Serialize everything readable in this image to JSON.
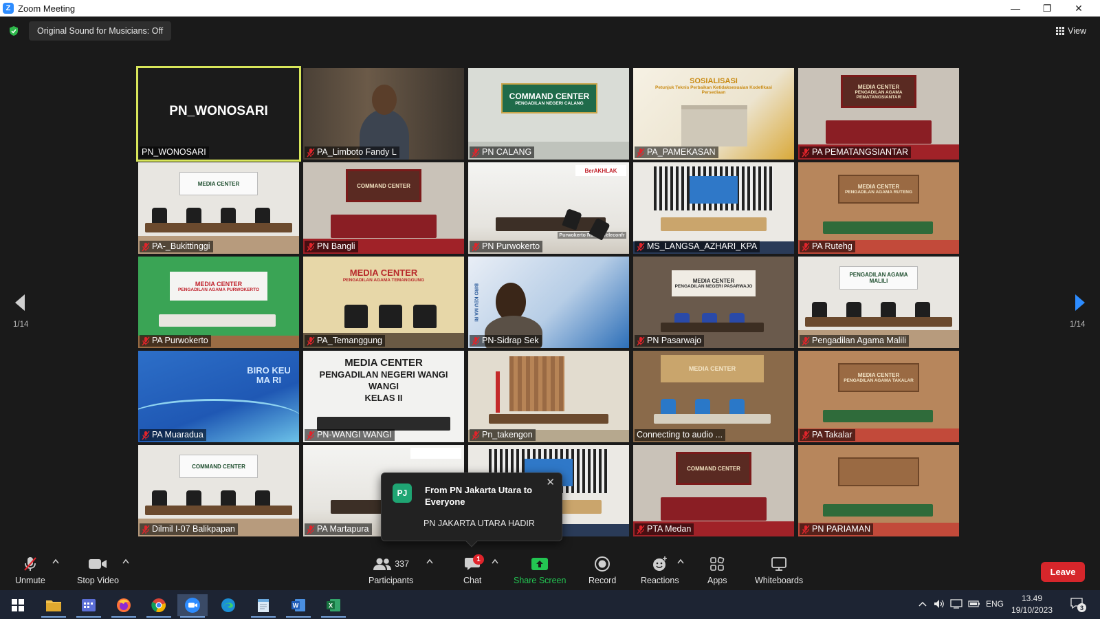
{
  "window": {
    "title": "Zoom Meeting",
    "controls": [
      "minimize-icon",
      "restore-icon",
      "close-icon"
    ]
  },
  "topbar": {
    "sound_label": "Original Sound for Musicians: Off",
    "view_label": "View",
    "security": "shield-check-icon",
    "shield_color": "#2eb84b"
  },
  "grid": {
    "page_left": "1/14",
    "page_right": "1/14",
    "active_tile_color": "#d8e65a",
    "tiles": [
      {
        "name": "PN_WONOSARI",
        "big_label": "PN_WONOSARI",
        "muted": false,
        "scene": "blank",
        "active": true
      },
      {
        "name": "PA_Limboto Fandy L",
        "muted": true,
        "scene": "person"
      },
      {
        "name": "PN CALANG",
        "muted": true,
        "scene": "command-center",
        "wall_text": "COMMAND CENTER",
        "wall_sub": "PENGADILAN NEGERI CALANG"
      },
      {
        "name": "PA_PAMEKASAN",
        "muted": true,
        "scene": "poster",
        "wall_text": "SOSIALISASI",
        "wall_sub": "Petunjuk Teknis Perbaikan Ketidaksesuaian Kodefikasi Persediaan"
      },
      {
        "name": "PA PEMATANGSIANTAR",
        "muted": true,
        "scene": "red-room",
        "wall_text": "MEDIA CENTER",
        "wall_sub": "PENGADILAN AGAMA PEMATANGSIANTAR"
      },
      {
        "name": "PA-_Bukittinggi",
        "muted": true,
        "scene": "meeting-room",
        "wall_text": "MEDIA CENTER"
      },
      {
        "name": "PN Bangli",
        "muted": true,
        "scene": "red-room",
        "wall_text": "COMMAND CENTER"
      },
      {
        "name": "PN Purwokerto",
        "muted": true,
        "scene": "white-room",
        "wall_text": "BerAKHLAK",
        "extra": "Purwokerto Ruang Teleconfr"
      },
      {
        "name": "MS_LANGSA_AZHARI_KPA",
        "muted": true,
        "scene": "screen-room"
      },
      {
        "name": "PA Rutehg",
        "muted": true,
        "scene": "wood-room",
        "wall_text": "MEDIA CENTER",
        "wall_sub": "PENGADILAN AGAMA RUTENG"
      },
      {
        "name": "PA Purwokerto",
        "muted": true,
        "scene": "green-room",
        "wall_text": "MEDIA CENTER",
        "wall_sub": "PENGADILAN AGAMA PURWOKERTO"
      },
      {
        "name": "PA_Temanggung",
        "muted": true,
        "scene": "cream-room",
        "wall_text": "MEDIA CENTER",
        "wall_sub": "PENGADILAN AGAMA TEMANGGUNG"
      },
      {
        "name": "PN-Sidrap Sek",
        "muted": true,
        "scene": "blue-person",
        "wall_text": "BIRO KEU MA RI"
      },
      {
        "name": "PN Pasarwajo",
        "muted": true,
        "scene": "dark-room",
        "wall_text": "MEDIA CENTER",
        "wall_sub": "PENGADILAN NEGERI PASARWAJO"
      },
      {
        "name": "Pengadilan Agama Malili",
        "muted": true,
        "scene": "meeting-room",
        "wall_text": "PENGADILAN AGAMA MALILI"
      },
      {
        "name": "PA Muaradua",
        "muted": true,
        "scene": "blue-poster",
        "wall_text": "BIRO KEU MA RI"
      },
      {
        "name": "PN-WANGI WANGI",
        "muted": true,
        "scene": "wangi",
        "wall_text": "MEDIA CENTER",
        "wall_sub": "PENGADILAN NEGERI WANGI WANGI",
        "wall_sub2": "KELAS II"
      },
      {
        "name": "Pn_takengon",
        "muted": true,
        "scene": "curtain-room"
      },
      {
        "name": "Connecting to audio ...",
        "muted": false,
        "scene": "blue-chairs",
        "wall_text": "MEDIA CENTER"
      },
      {
        "name": "PA Takalar",
        "muted": true,
        "scene": "wood-room",
        "wall_text": "MEDIA CENTER",
        "wall_sub": "PENGADILAN AGAMA TAKALAR"
      },
      {
        "name": "Dilmil I-07 Balikpapan",
        "muted": true,
        "scene": "meeting-room",
        "wall_text": "COMMAND CENTER"
      },
      {
        "name": "PA Martapura",
        "muted": true,
        "scene": "white-room"
      },
      {
        "name": "",
        "muted": false,
        "scene": "screen-room"
      },
      {
        "name": "PTA Medan",
        "muted": true,
        "scene": "red-room",
        "wall_text": "COMMAND CENTER"
      },
      {
        "name": "PN PARIAMAN",
        "muted": true,
        "scene": "wood-room"
      }
    ]
  },
  "toast": {
    "avatar": "PJ",
    "from": "From PN Jakarta Utara to Everyone",
    "message": "PN JAKARTA UTARA HADIR",
    "avatar_color": "#1fa573"
  },
  "toolbar": {
    "unmute": "Unmute",
    "stop_video": "Stop Video",
    "participants": "Participants",
    "participants_count": "337",
    "chat": "Chat",
    "chat_badge": "1",
    "share": "Share Screen",
    "share_color": "#23c552",
    "record": "Record",
    "reactions": "Reactions",
    "apps": "Apps",
    "whiteboards": "Whiteboards",
    "leave": "Leave",
    "leave_color": "#d6262b"
  },
  "taskbar": {
    "apps": [
      "windows-start-icon",
      "file-explorer-icon",
      "calendar-app-icon",
      "firefox-icon",
      "chrome-icon",
      "zoom-icon",
      "edge-icon",
      "notepad-icon",
      "word-icon",
      "excel-icon"
    ],
    "lang": "ENG",
    "time": "13.49",
    "date": "19/10/2023",
    "notif_count": "3"
  }
}
